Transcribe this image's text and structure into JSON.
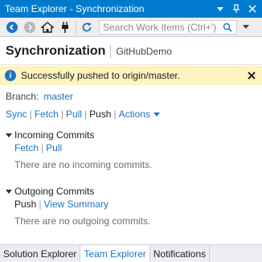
{
  "window": {
    "title": "Team Explorer - Synchronization"
  },
  "toolbar": {
    "search_placeholder": "Search Work Items (Ctrl+')"
  },
  "header": {
    "page_title": "Synchronization",
    "repo_name": "GitHubDemo"
  },
  "info_bar": {
    "message": "Successfully pushed to origin/master."
  },
  "branch": {
    "label": "Branch:",
    "name": "master"
  },
  "actions": {
    "sync": "Sync",
    "fetch": "Fetch",
    "pull": "Pull",
    "push": "Push",
    "actions": "Actions"
  },
  "incoming": {
    "title": "Incoming Commits",
    "fetch": "Fetch",
    "pull": "Pull",
    "empty": "There are no incoming commits."
  },
  "outgoing": {
    "title": "Outgoing Commits",
    "push": "Push",
    "view_summary": "View Summary",
    "empty": "There are no outgoing commits."
  },
  "tabs": [
    {
      "label": "Solution Explorer"
    },
    {
      "label": "Team Explorer"
    },
    {
      "label": "Notifications"
    }
  ],
  "colors": {
    "accent": "#007acc",
    "link": "#1e74c4",
    "info_bg": "#fdf4bf"
  }
}
